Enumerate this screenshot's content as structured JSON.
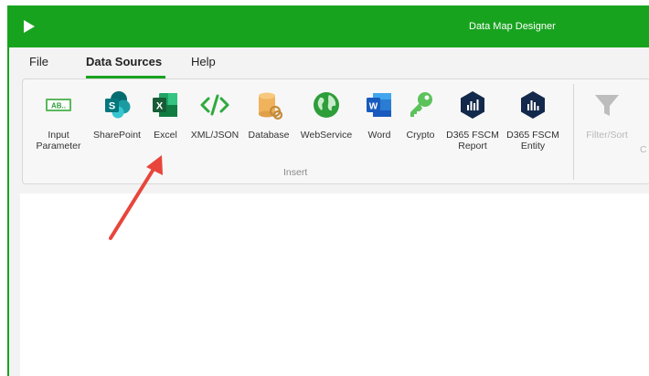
{
  "window": {
    "title": "Data Map Designer"
  },
  "menu": {
    "file": "File",
    "data_sources": "Data Sources",
    "help": "Help"
  },
  "ribbon": {
    "buttons": {
      "input_parameter": "Input\nParameter",
      "sharepoint": "SharePoint",
      "excel": "Excel",
      "xml_json": "XML/JSON",
      "database": "Database",
      "webservice": "WebService",
      "word": "Word",
      "crypto": "Crypto",
      "d365_report": "D365 FSCM\nReport",
      "d365_entity": "D365 FSCM\nEntity",
      "filter_sort": "Filter/Sort",
      "cut": "C"
    },
    "group_label": "Insert",
    "icon_text": {
      "input_parameter": "AB..",
      "sharepoint": "S",
      "excel": "X",
      "word": "W"
    }
  },
  "colors": {
    "brand": "#18a31f",
    "arrow": "#e8453c"
  },
  "icons": [
    "play-icon",
    "input-parameter-icon",
    "sharepoint-icon",
    "excel-icon",
    "xml-json-icon",
    "database-icon",
    "webservice-icon",
    "word-icon",
    "crypto-icon",
    "d365-report-icon",
    "d365-entity-icon",
    "filter-icon"
  ]
}
